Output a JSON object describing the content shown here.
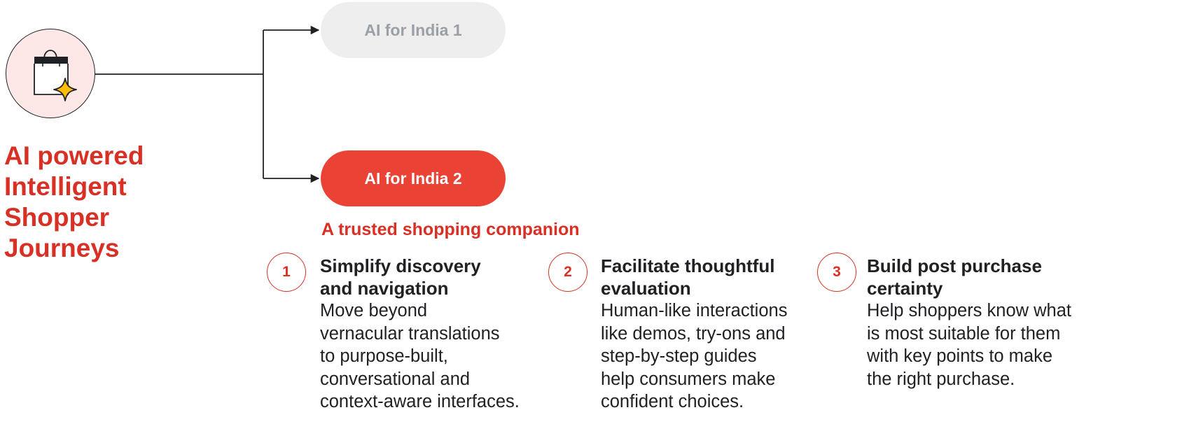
{
  "diagram": {
    "main_title_lines": [
      "AI powered",
      "Intelligent",
      "Shopper",
      "Journeys"
    ],
    "root_icon": "shopping-bag-sparkle-icon",
    "branches": [
      {
        "label": "AI for India 1",
        "state": "inactive"
      },
      {
        "label": "AI for India 2",
        "state": "active"
      }
    ],
    "active_branch_subtitle": "A trusted shopping companion",
    "steps": [
      {
        "number": "1",
        "title_lines": [
          "Simplify discovery",
          "and navigation"
        ],
        "body_lines": [
          "Move beyond",
          "vernacular translations",
          "to purpose-built,",
          "conversational and",
          "context-aware interfaces."
        ]
      },
      {
        "number": "2",
        "title_lines": [
          "Facilitate thoughtful",
          "evaluation"
        ],
        "body_lines": [
          "Human-like interactions",
          "like demos, try-ons and",
          "step-by-step guides",
          "help consumers make",
          "confident choices."
        ]
      },
      {
        "number": "3",
        "title_lines": [
          "Build post purchase",
          "certainty"
        ],
        "body_lines": [
          "Help shoppers know what",
          "is most suitable for them",
          "with key points to make",
          "the right purchase."
        ]
      }
    ],
    "colors": {
      "accent_red": "#d93025",
      "active_pill": "#ea4335",
      "inactive_pill": "#eeeeee",
      "inactive_pill_text": "#9aa0a6",
      "icon_background": "#fde8e7",
      "sparkle": "#fbbc04"
    }
  }
}
